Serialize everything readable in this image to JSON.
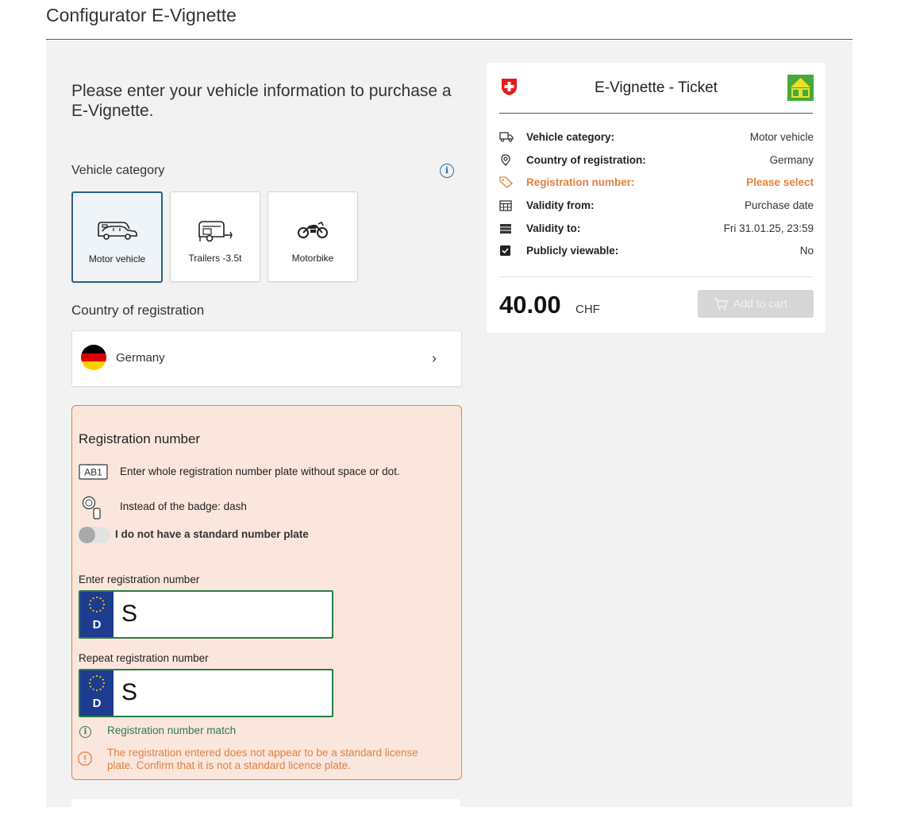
{
  "page": {
    "title": "Configurator E-Vignette"
  },
  "intro": "Please enter your vehicle information to purchase a E-Vignette.",
  "vehicle_category": {
    "label": "Vehicle category",
    "options": [
      {
        "label": "Motor vehicle",
        "selected": true,
        "icon": "car-with-camper-icon"
      },
      {
        "label": "Trailers -3.5t",
        "selected": false,
        "icon": "trailer-icon"
      },
      {
        "label": "Motorbike",
        "selected": false,
        "icon": "motorbike-icon"
      }
    ]
  },
  "country": {
    "label": "Country of registration",
    "value": "Germany",
    "flag_colors": [
      "#000000",
      "#dd0000",
      "#ffce00"
    ]
  },
  "registration": {
    "title": "Registration number",
    "hint_plate": "Enter whole registration number plate without space or dot.",
    "hint_plate_icon_text": "AB1",
    "hint_badge": "Instead of the badge: dash",
    "toggle_label": "I do not have a standard number plate",
    "toggle_on": false,
    "enter_label": "Enter registration number",
    "enter_value": "S",
    "repeat_label": "Repeat registration number",
    "repeat_value": "S",
    "plate_country_code": "D",
    "match_message": "Registration number match",
    "warning_message_line1": "The registration entered does not appear to be a standard license",
    "warning_message_line2": "plate. Confirm that it is not a standard licence plate."
  },
  "ticket": {
    "title": "E-Vignette - Ticket",
    "rows": [
      {
        "key": "Vehicle category:",
        "value": "Motor vehicle",
        "icon": "truck-icon",
        "warn": false
      },
      {
        "key": "Country of registration:",
        "value": "Germany",
        "icon": "location-pin-icon",
        "warn": false
      },
      {
        "key": "Registration number:",
        "value": "Please select",
        "icon": "tag-icon",
        "warn": true
      },
      {
        "key": "Validity from:",
        "value": "Purchase date",
        "icon": "calendar-icon",
        "warn": false
      },
      {
        "key": "Validity to:",
        "value": "Fri 31.01.25, 23:59",
        "icon": "calendar-filled-icon",
        "warn": false
      },
      {
        "key": "Publicly viewable:",
        "value": "No",
        "icon": "checkbox-checked-icon",
        "warn": false
      }
    ],
    "price": "40.00",
    "currency": "CHF",
    "add_to_cart": "Add to cart"
  },
  "colors": {
    "accent": "#2b6182",
    "warning": "#e0823f",
    "success": "#2e7a48",
    "panel_bg": "#f2f2f2",
    "error_bg": "#fbe6dd"
  }
}
